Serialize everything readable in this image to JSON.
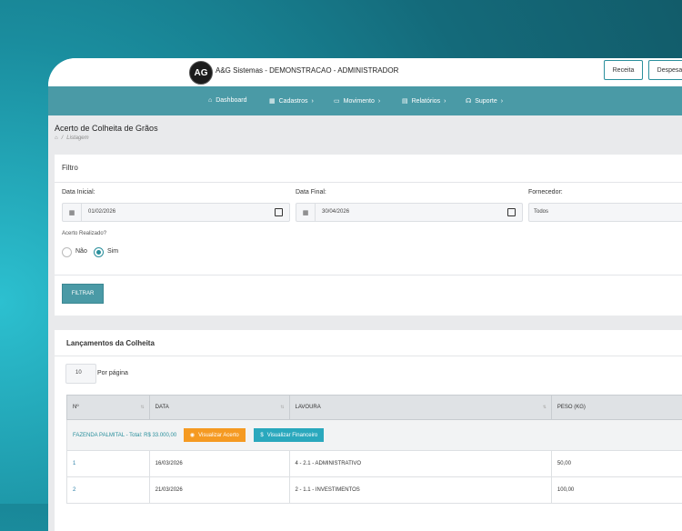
{
  "header": {
    "logo_text": "AG",
    "title": "A&G Sistemas - DEMONSTRACAO - ADMINISTRADOR",
    "btn_receita": "Receita",
    "btn_despesa": "Despesa"
  },
  "nav": {
    "items": [
      {
        "label": "Dashboard",
        "icon": "home-icon"
      },
      {
        "label": "Cadastros",
        "icon": "grid-icon"
      },
      {
        "label": "Movimento",
        "icon": "video-icon"
      },
      {
        "label": "Relatórios",
        "icon": "document-icon"
      },
      {
        "label": "Suporte",
        "icon": "headset-icon"
      }
    ]
  },
  "page": {
    "title": "Acerto de Colheita de Grãos",
    "breadcrumb": "Listagem"
  },
  "filter": {
    "title": "Filtro",
    "date_start_label": "Data Inicial:",
    "date_start_value": "01/02/2026",
    "date_end_label": "Data Final:",
    "date_end_value": "30/04/2026",
    "supplier_label": "Fornecedor:",
    "supplier_value": "Todos",
    "acerto_label": "Acerto Realizado?",
    "option_no": "Não",
    "option_yes": "Sim",
    "selected": "Sim",
    "button": "FILTRAR"
  },
  "list": {
    "title": "Lançamentos da Colheita",
    "per_page_value": "10",
    "per_page_label": "Por página",
    "columns": [
      "Nº",
      "DATA",
      "LAVOURA",
      "PESO (KG)"
    ],
    "group": {
      "label": "FAZENDA PALMITAL - Total: R$ 33.000,00",
      "btn_acerto": "Visualizar Acerto",
      "btn_financeiro": "Visualizar Financeiro"
    },
    "rows": [
      {
        "num": "1",
        "data": "16/03/2026",
        "lavoura": "4 - 2.1 - ADMINISTRATIVO",
        "peso": "50,00"
      },
      {
        "num": "2",
        "data": "21/03/2026",
        "lavoura": "2 - 1.1 - INVESTIMENTOS",
        "peso": "100,00"
      }
    ]
  },
  "colors": {
    "accent": "#4a9aa6",
    "orange": "#f59a22",
    "cyan": "#2aa8bd"
  }
}
